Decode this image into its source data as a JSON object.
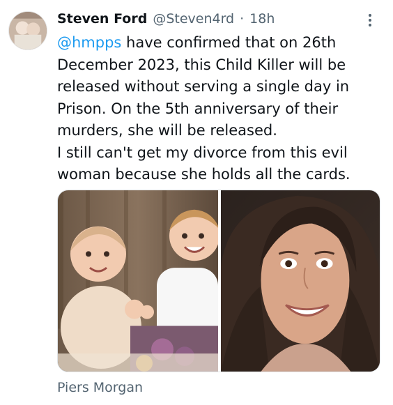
{
  "tweet": {
    "author_name": "Steven Ford",
    "author_handle": "@Steven4rd",
    "separator": "·",
    "time": "18h",
    "mention": "@hmpps",
    "lines": [
      " have confirmed that on 26th",
      "December 2023, this Child Killer will be",
      "released without serving a single day in",
      "Prison. On the 5th anniversary of their",
      "murders, she will be released.",
      "I still can't get my divorce from this evil",
      "woman because she holds all the cards."
    ],
    "source": "Piers Morgan"
  },
  "icons": {
    "more": "more-vertical-icon"
  },
  "colors": {
    "link": "#1d9bf0",
    "secondary_text": "#536471",
    "primary_text": "#0f1419"
  }
}
